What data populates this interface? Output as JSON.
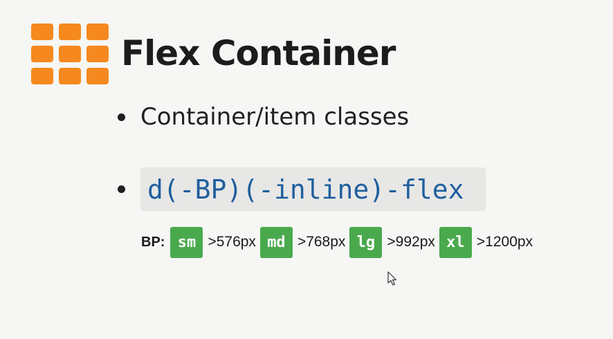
{
  "slide": {
    "title": "Flex Container",
    "bullets": [
      {
        "text": "Container/item classes"
      },
      {
        "text": "d(-BP)(-inline)-flex"
      }
    ],
    "breakpoints": {
      "label": "BP:",
      "items": [
        {
          "code": "sm",
          "value": ">576px"
        },
        {
          "code": "md",
          "value": ">768px"
        },
        {
          "code": "lg",
          "value": ">992px"
        },
        {
          "code": "xl",
          "value": ">1200px"
        }
      ]
    }
  },
  "icons": {
    "logo": "grid-icon",
    "pointer": "mouse-cursor-icon"
  },
  "colors": {
    "logo_orange": "#f5891f",
    "badge_green": "#4aa94d",
    "code_blue": "#1f5f9e",
    "code_background": "#e7e7e6",
    "page_background": "#f6f6f4"
  }
}
